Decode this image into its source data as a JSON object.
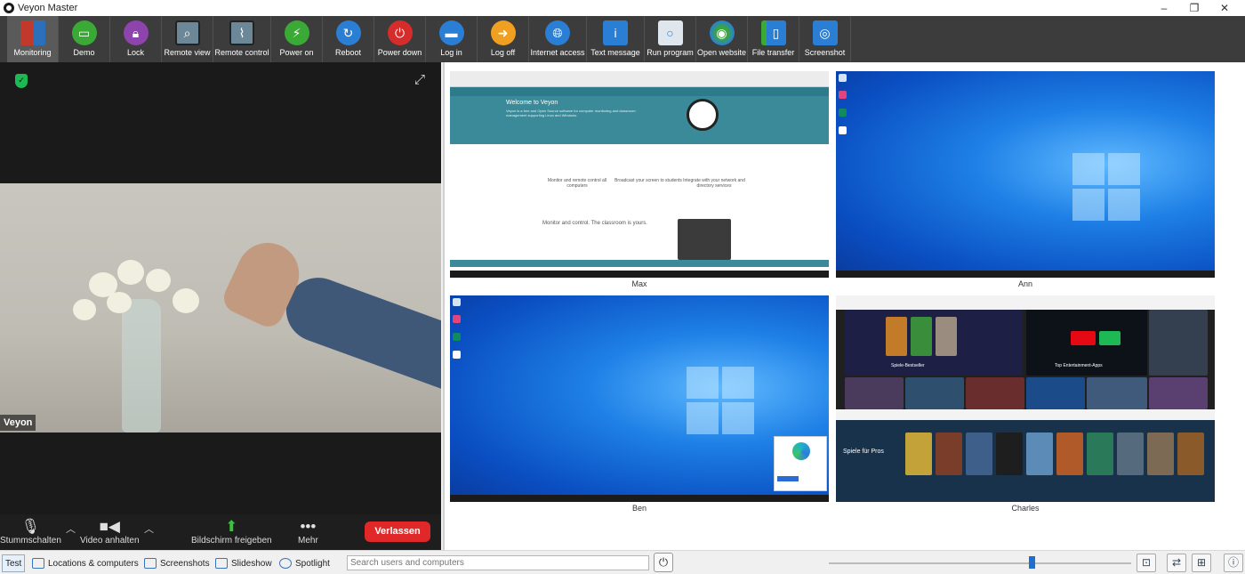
{
  "window": {
    "title": "Veyon Master"
  },
  "toolbar": {
    "buttons": [
      {
        "label": "Monitoring",
        "icon": "monitoring-icon",
        "color": "#c0392b"
      },
      {
        "label": "Demo",
        "icon": "demo-icon",
        "color": "#3aa935"
      },
      {
        "label": "Lock",
        "icon": "lock-icon",
        "color": "#8e44ad"
      },
      {
        "label": "Remote view",
        "icon": "remote-view-icon",
        "color": "#5d7b8e"
      },
      {
        "label": "Remote control",
        "icon": "remote-control-icon",
        "color": "#5d7b8e"
      },
      {
        "label": "Power on",
        "icon": "power-on-icon",
        "color": "#3aa935"
      },
      {
        "label": "Reboot",
        "icon": "reboot-icon",
        "color": "#2a7fd4"
      },
      {
        "label": "Power down",
        "icon": "power-down-icon",
        "color": "#d62c2c"
      },
      {
        "label": "Log in",
        "icon": "log-in-icon",
        "color": "#2a7fd4"
      },
      {
        "label": "Log off",
        "icon": "log-off-icon",
        "color": "#f0a020"
      },
      {
        "label": "Internet access",
        "icon": "internet-access-icon",
        "color": "#2a7fd4"
      },
      {
        "label": "Text message",
        "icon": "text-message-icon",
        "color": "#2a7fd4"
      },
      {
        "label": "Run program",
        "icon": "run-program-icon",
        "color": "#dfe6ee"
      },
      {
        "label": "Open website",
        "icon": "open-website-icon",
        "color": "#2a7fd4"
      },
      {
        "label": "File transfer",
        "icon": "file-transfer-icon",
        "color": "#2a7fd4"
      },
      {
        "label": "Screenshot",
        "icon": "screenshot-icon",
        "color": "#2a7fd4"
      }
    ]
  },
  "zoom": {
    "participant_name": "Veyon",
    "controls": {
      "mute": "Stummschalten",
      "stop_video": "Video anhalten",
      "share_screen": "Bildschirm freigeben",
      "more": "Mehr",
      "leave": "Verlassen"
    }
  },
  "computers": [
    {
      "name": "Max"
    },
    {
      "name": "Ann"
    },
    {
      "name": "Ben"
    },
    {
      "name": "Charles"
    }
  ],
  "max_screen": {
    "hero_title": "Welcome to Veyon",
    "hero_text": "Veyon is a free and Open Source software for computer monitoring and classroom management supporting Linux and Windows.",
    "features": [
      "Monitor and remote control all computers",
      "Broadcast your screen to students",
      "Integrate with your network and directory services"
    ],
    "section_title": "Monitor and control. The classroom is yours."
  },
  "charles_screen": {
    "tile_bestseller": "Spiele-Bestseller",
    "tile_entertainment": "Top Entertainment-Apps",
    "banner": "Spiele für Pros"
  },
  "statusbar": {
    "test": "Test",
    "locations": "Locations & computers",
    "screenshots": "Screenshots",
    "slideshow": "Slideshow",
    "spotlight": "Spotlight",
    "search_placeholder": "Search users and computers",
    "zoom_level": 0.67
  }
}
